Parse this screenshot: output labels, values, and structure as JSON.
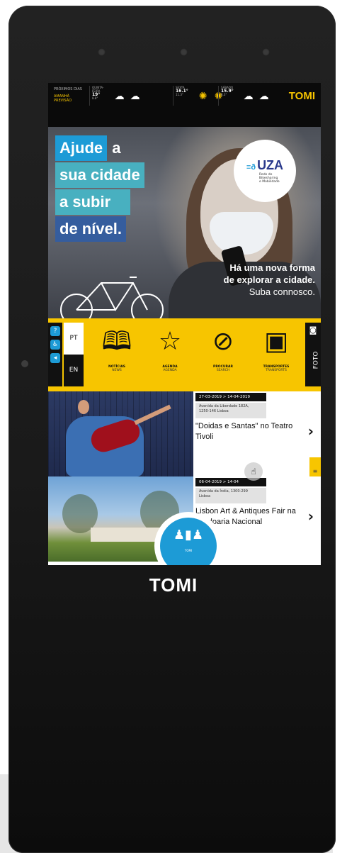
{
  "colors": {
    "accent_yellow": "#f7c500",
    "accent_blue": "#1d9bd6",
    "teal": "#48b0c0",
    "navy": "#355d9e",
    "bezel": "#1a1a1a"
  },
  "topbar": {
    "proximos_dias": "PRÓXIMOS DIAS",
    "highlight": "AMANHÃ PREVISÃO",
    "days": [
      {
        "label": "QUINTA-FEIRA",
        "temp": "19°",
        "sub": "8.8°",
        "icons": [
          "cloud-icon",
          "cloud-icon"
        ]
      },
      {
        "label": "SEXTA",
        "temp": "16.1°",
        "sub": "11.3°",
        "icons": [
          "sun-icon",
          "sun-icon"
        ]
      },
      {
        "label": "SÁBADO",
        "temp": "15.9°",
        "sub": "8.3°",
        "icons": [
          "cloud-icon",
          "cloud-icon"
        ]
      }
    ],
    "brand": "TOMI"
  },
  "hero": {
    "line1": "Ajude",
    "line1b": "a",
    "line2": "sua cidade",
    "line3": "a subir",
    "line4": "de nível.",
    "uza_logo": "UZA",
    "uza_sub1": "Rede de",
    "uza_sub2": "Bikesharing",
    "uza_sub3": "e Mobilidade",
    "tag1": "Há uma nova forma",
    "tag2": "de explorar a cidade.",
    "tag3": "Suba connosco."
  },
  "nav": {
    "lang_pt": "PT",
    "lang_en": "EN",
    "items": [
      {
        "icon": "book-icon",
        "label": "NOTÍCIAS",
        "sub": "NEWS"
      },
      {
        "icon": "star-icon",
        "label": "AGENDA",
        "sub": "AGENDA"
      },
      {
        "icon": "compass-icon",
        "label": "PROCURAR",
        "sub": "SEARCH"
      },
      {
        "icon": "bus-icon",
        "label": "TRANSPORTES",
        "sub": "TRANSPORTS"
      }
    ],
    "foto": "FOTO"
  },
  "events": [
    {
      "date": "27-03-2019 > 14-04-2019",
      "address_line1": "Avenida da Liberdade 182A,",
      "address_line2": "1250-146 Lisboa",
      "title": "\"Doidas e Santas\" no Teatro Tivoli"
    },
    {
      "date": "06-04-2019 > 14-04",
      "address_line1": "Avenida da Índia, 1300-299",
      "address_line2": "Lisboa",
      "title": "Lisbon Art & Antiques Fair na Cordoaria Nacional"
    }
  ],
  "home_button_label": "TOMI",
  "kiosk_brand": "TOMI"
}
